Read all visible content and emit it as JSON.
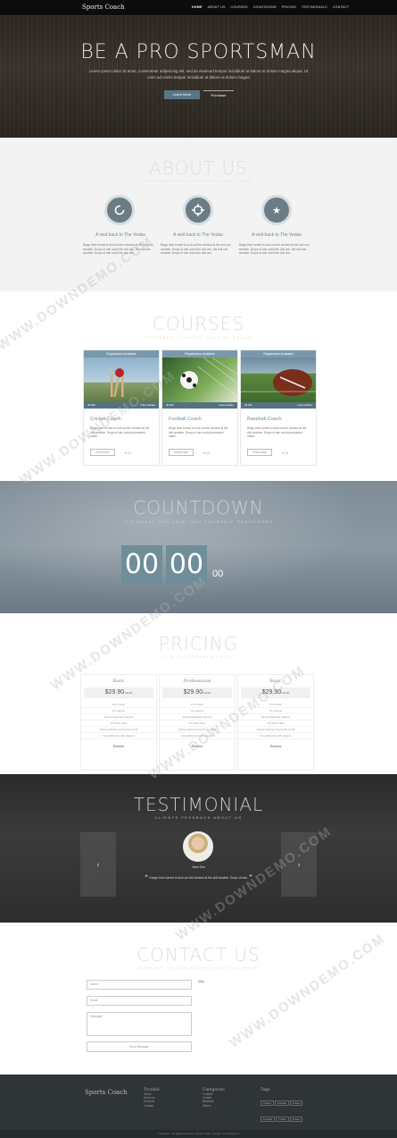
{
  "nav": {
    "brand": "Sports Coach",
    "items": [
      "HOME",
      "ABOUT US",
      "COURSES",
      "COUNTDOWN",
      "PRICING",
      "TESTIMONIALS",
      "CONTACT"
    ]
  },
  "hero": {
    "title": "BE A PRO SPORTSMAN",
    "text": "Lorem ipsum dolor sit amet, consectetur adipisicing elit, sed do eiusmod tempor incididunt ut labore et dolore magna aliqua. Ut enim ad minim tempor incididunt ut labore et dolore magna",
    "learn_label": "Learn More",
    "purchase_label": "Purchase"
  },
  "about": {
    "title": "ABOUT US",
    "subtitle": "FEATURED PROJECTS THAT WE LOVE",
    "features": [
      {
        "icon": "refresh-icon",
        "title": "A visit back to The Vedas",
        "text": "Bingo then turned to look out the window at the dull one, weather. Drops of rain could the dull one, the dull one weather. Drops of rain could the dull one."
      },
      {
        "icon": "crosshair-icon",
        "title": "A visit back to The Vedas",
        "text": "Bingo then turned to look out the window at the dull one, weather. Drops of rain could the dull one, the dull one weather. Drops of rain could the dull one."
      },
      {
        "icon": "star-icon",
        "title": "A visit back to The Vedas",
        "text": "Bingo then turned to look out the window at the dull one, weather. Drops of rain could the dull one, the dull one weather. Drops of rain could the dull one."
      }
    ]
  },
  "courses": {
    "title": "COURSES",
    "subtitle": "FEATURED COURSES THAT WE TEACH",
    "cards": [
      {
        "ribbon": "Registration Available",
        "dur": "40 Min",
        "level": "Intermediate",
        "title": "Cricket Coach",
        "text": "Bingo then turned to look out the window at the dull weather. Drops of rain could persuaded made.",
        "enroll": "Enroll now",
        "likes": "10"
      },
      {
        "ribbon": "Registration Available",
        "dur": "40 Min",
        "level": "Intermediate",
        "title": "Football Coach",
        "text": "Bingo then turned to look out the window at the dull weather. Drops of rain could persuaded made.",
        "enroll": "Enroll now",
        "likes": "10"
      },
      {
        "ribbon": "Registration Available",
        "dur": "40 Min",
        "level": "Intermediate",
        "title": "Baseball Coach",
        "text": "Bingo then turned to look out the window at the dull weather. Drops of rain could persuaded made.",
        "enroll": "Enroll now",
        "likes": "10"
      }
    ]
  },
  "countdown": {
    "title": "COUNTDOWN",
    "subtitle": "IT'S NEVER TOO LATE, GET YOURSELF REGISTERED",
    "h1": "00",
    "h2": "00",
    "small": "00"
  },
  "pricing": {
    "title": "PRICING",
    "subtitle": "IT'S AFFORDABLE PRICE",
    "plans": [
      {
        "name": "Basic",
        "price": "$29.90",
        "per": "/month",
        "features": [
          "Pro Coach",
          "No support",
          "Sports Materials Support",
          "10 Video Files",
          "Online training around the world",
          "Cost-Effective with players"
        ],
        "button": "Renew"
      },
      {
        "name": "Professional",
        "price": "$29.90",
        "per": "/month",
        "features": [
          "Pro Coach",
          "No support",
          "Sports Materials Support",
          "10 Video Files",
          "Online training around the world",
          "Cost-Effective with players"
        ],
        "button": "Renew"
      },
      {
        "name": "Basic",
        "price": "$29.90",
        "per": "/month",
        "features": [
          "Pro Coach",
          "No support",
          "Sports Materials Support",
          "10 Video Files",
          "Online training around the world",
          "Cost-Effective with players"
        ],
        "button": "Renew"
      }
    ]
  },
  "testimonial": {
    "title": "TESTIMONIAL",
    "subtitle": "CLIENTS FEEDBACK ABOUT US",
    "name": "Jane Doe",
    "quote": "Gregor then turned to look out the window at the dull weather. Drops of rain.",
    "prev": "‹",
    "next": "›"
  },
  "contact": {
    "title": "CONTACT US",
    "subtitle": "CONTACT US FOR EVERYTHING YOU NEED",
    "name_ph": "Name",
    "email_ph": "Email",
    "message_ph": "Message",
    "send_label": "Send Message",
    "map_label": "Map"
  },
  "footer": {
    "brand": "Sports Coach",
    "col1_title": "Trouble",
    "col1": [
      "Home",
      "About us",
      "Services",
      "Contact"
    ],
    "col2_title": "Categories",
    "col2": [
      "Football",
      "Cricket",
      "Baseball",
      "Others"
    ],
    "tags_title": "Tags",
    "tags": [
      "Cricket",
      "Football",
      "Cricket",
      "Football",
      "Cricket",
      "Cricket"
    ],
    "copyright": "© Designer - All Rights Reserved. Sports Coach - Design from W3Layouts"
  },
  "watermark": "WWW.DOWNDEMO.COM",
  "colors": {
    "accent": "#5a7585",
    "dark": "#0c0c0c",
    "footer": "#2f3436"
  }
}
